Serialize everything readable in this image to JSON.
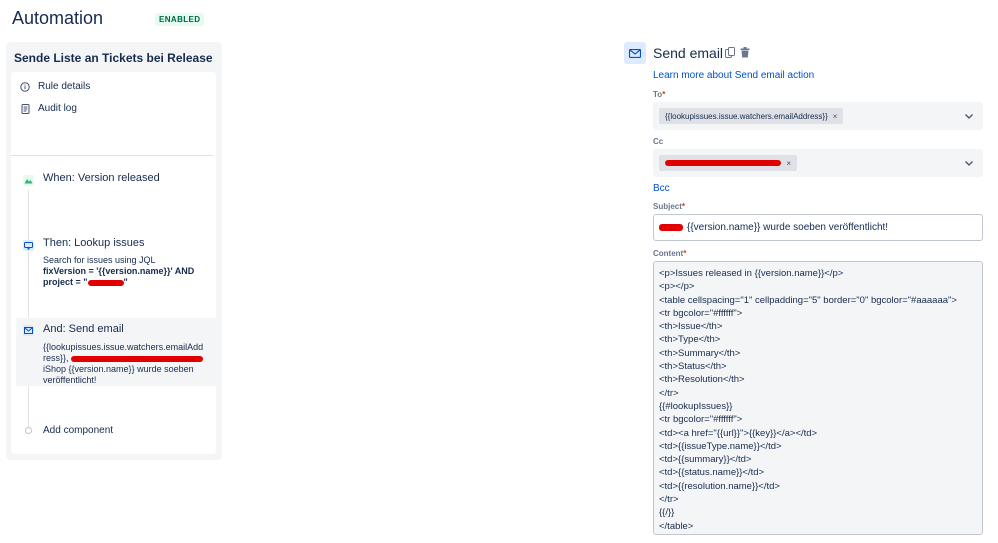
{
  "header": {
    "title": "Automation",
    "status": "ENABLED"
  },
  "rule": {
    "name": "Sende Liste an Tickets bei Release",
    "menu": [
      {
        "label": "Rule details",
        "icon": "info-icon"
      },
      {
        "label": "Audit log",
        "icon": "document-icon"
      }
    ],
    "steps": {
      "trigger": {
        "title": "When: Version released"
      },
      "lookup": {
        "title": "Then: Lookup issues",
        "desc_plain": "Search for issues using JQL",
        "desc_bold1": "fixVersion = '{{version.name}}' AND",
        "desc_bold2": "project = \"",
        "desc_bold2_end": "\""
      },
      "email": {
        "title": "And: Send email",
        "line1": "{{lookupissues.issue.watchers.emailAdd",
        "line2a": "ress}},",
        "line3": "iShop {{version.name}} wurde soeben",
        "line4": "veröffentlicht!"
      },
      "add": {
        "label": "Add component"
      }
    }
  },
  "action": {
    "title": "Send email",
    "learn_more": "Learn more about Send email action",
    "to": {
      "label": "To",
      "required": "*",
      "chip": "{{lookupissues.issue.watchers.emailAddress}}",
      "remove": "×"
    },
    "cc": {
      "label": "Cc",
      "remove": "×"
    },
    "bcc": "Bcc",
    "subject": {
      "label": "Subject",
      "required": "*",
      "value": "{{version.name}} wurde soeben veröffentlicht!"
    },
    "content": {
      "label": "Content",
      "required": "*",
      "lines": [
        "<p>Issues released in {{version.name}}</p>",
        "<p></p>",
        "<table cellspacing=\"1\" cellpadding=\"5\" border=\"0\" bgcolor=\"#aaaaaa\">",
        "<tr bgcolor=\"#ffffff\">",
        "<th>Issue</th>",
        "<th>Type</th>",
        "<th>Summary</th>",
        "<th>Status</th>",
        "<th>Resolution</th>",
        "</tr>",
        "{{#lookupIssues}}",
        "<tr bgcolor=\"#ffffff\">",
        "<td><a href=\"{{url}}\">{{key}}</a></td>",
        "<td>{{issueType.name}}</td>",
        "<td>{{summary}}</td>",
        "<td>{{status.name}}</td>",
        "<td>{{resolution.name}}</td>",
        "</tr>",
        "{{/}}",
        "</table>"
      ]
    }
  },
  "colors": {
    "accent": "#0052cc",
    "redaction": "#e00000",
    "enabled_green": "#006644",
    "required": "#de350b"
  }
}
